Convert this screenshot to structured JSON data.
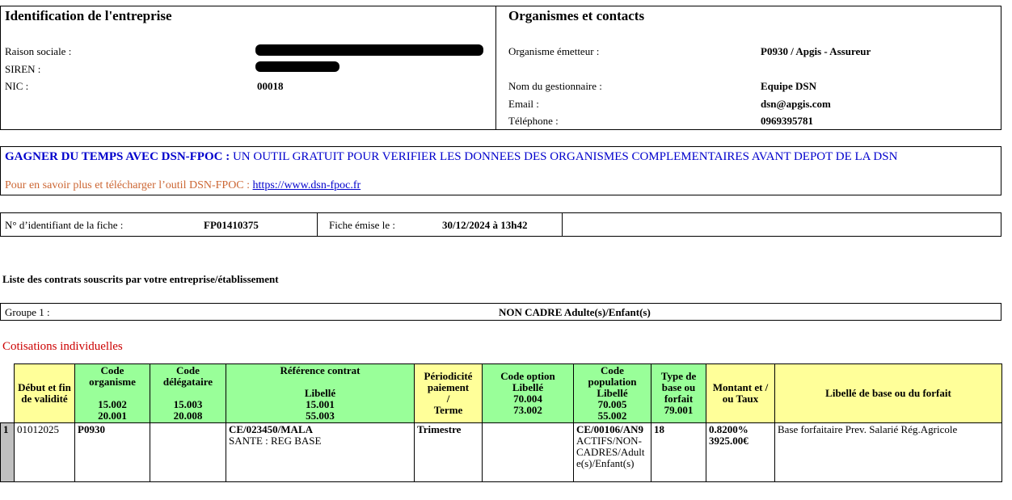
{
  "identification": {
    "title": "Identification de l'entreprise",
    "raison_sociale_label": "Raison sociale :",
    "siren_label": "SIREN :",
    "nic_label": "NIC :",
    "nic_value": "00018"
  },
  "organismes": {
    "title": "Organismes et contacts",
    "emetteur_label": "Organisme émetteur :",
    "emetteur_value": "P0930 / Apgis - Assureur",
    "gestionnaire_label": "Nom du gestionnaire :",
    "gestionnaire_value": "Equipe DSN",
    "email_label": "Email :",
    "email_value": "dsn@apgis.com",
    "telephone_label": "Téléphone :",
    "telephone_value": "0969395781"
  },
  "banner": {
    "headline_bold": "GAGNER DU TEMPS AVEC DSN-FPOC :",
    "headline_rest": " UN OUTIL GRATUIT POUR VERIFIER LES DONNEES DES ORGANISMES COMPLEMENTAIRES AVANT DEPOT DE LA DSN",
    "info_text": "Pour en savoir plus et télécharger l’outil DSN-FPOC : ",
    "link_text": "https://www.dsn-fpoc.fr",
    "headline_color": "#0000cc",
    "info_color": "#cc6633"
  },
  "fiche": {
    "id_label": "N° d’identifiant de la fiche :",
    "id_value": "FP01410375",
    "date_label": "Fiche émise le :",
    "date_value": "30/12/2024 à 13h42"
  },
  "contracts_title": "Liste des contrats souscrits par votre entreprise/établissement",
  "groupe": {
    "label": "Groupe 1 :",
    "value": "NON CADRE Adulte(s)/Enfant(s)"
  },
  "cotisations_title": "Cotisations individuelles",
  "table": {
    "headers": {
      "debut": "Début et fin de validité",
      "code_org_title": "Code organisme",
      "code_org_a": "15.002",
      "code_org_b": "20.001",
      "code_del_title": "Code délégataire",
      "code_del_a": "15.003",
      "code_del_b": "20.008",
      "ref_title": "Référence contrat",
      "ref_libelle": "Libellé",
      "ref_a": "15.001",
      "ref_b": "55.003",
      "periodicite": "Périodicité paiement",
      "periodicite_slash": "/",
      "periodicite_terme": "Terme",
      "code_option_title": "Code option",
      "code_option_libelle": "Libellé",
      "code_option_a": "70.004",
      "code_option_b": "73.002",
      "code_pop_title": "Code population",
      "code_pop_libelle": "Libellé",
      "code_pop_a": "70.005",
      "code_pop_b": "55.002",
      "type_base": "Type de base ou forfait",
      "type_base_code": "79.001",
      "montant": "Montant et / ou Taux",
      "libelle_base": "Libellé de base ou du forfait"
    },
    "row": {
      "index": "1",
      "debut": "01012025",
      "code_org": "P0930",
      "code_del": "",
      "ref_contrat": "CE/023450/MALA",
      "ref_libelle": "SANTE : REG BASE",
      "periodicite": "Trimestre",
      "code_option": "",
      "code_pop": "CE/00106/AN9",
      "code_pop_libelle": "ACTIFS/NON-CADRES/Adulte(s)/Enfant(s)",
      "type_base": "18",
      "taux": "0.8200%",
      "montant": "3925.00€",
      "libelle_base": "Base forfaitaire Prev. Salarié Rég.Agricole"
    }
  },
  "colors": {
    "header_yellow": "#ffff99",
    "header_green": "#99ff99",
    "cotisations_red": "#cc0000",
    "index_gray": "#c0c0c0"
  }
}
